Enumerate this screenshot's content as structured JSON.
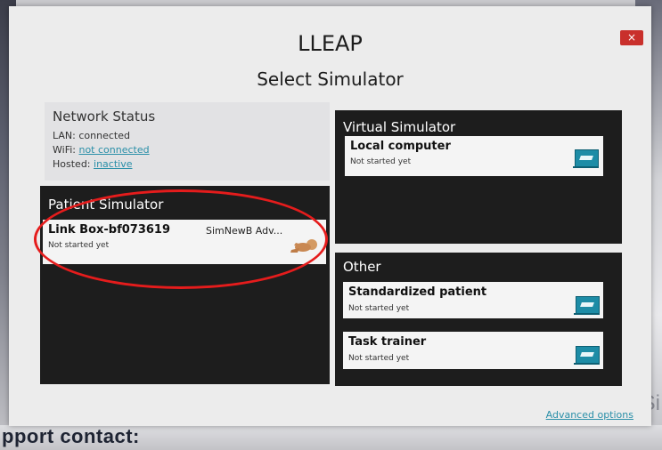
{
  "window": {
    "app_title": "LLEAP",
    "page_title": "Select Simulator",
    "close_label": "×"
  },
  "network_status": {
    "heading": "Network Status",
    "lan_label": "LAN:",
    "lan_value": "connected",
    "wifi_label": "WiFi:",
    "wifi_value": "not connected",
    "hosted_label": "Hosted:",
    "hosted_value": "inactive"
  },
  "patient_simulator": {
    "title": "Patient Simulator",
    "items": [
      {
        "name": "Link Box-bf073619",
        "model": "SimNewB Adv...",
        "status": "Not started yet",
        "icon": "newborn-manikin-icon"
      }
    ]
  },
  "virtual_simulator": {
    "title": "Virtual Simulator",
    "items": [
      {
        "name": "Local computer",
        "status": "Not started yet",
        "icon": "laptop-icon"
      }
    ]
  },
  "other": {
    "title": "Other",
    "items": [
      {
        "name": "Standardized patient",
        "status": "Not started yet",
        "icon": "laptop-icon"
      },
      {
        "name": "Task trainer",
        "status": "Not started yet",
        "icon": "laptop-icon"
      }
    ]
  },
  "advanced_options_label": "Advanced options",
  "background": {
    "partial_text": "pport contact:",
    "partial_letter": "Si"
  },
  "colors": {
    "panel_dark": "#1d1d1d",
    "link": "#2a8fa8",
    "close": "#c9302c",
    "annotation": "#e51c1c"
  }
}
